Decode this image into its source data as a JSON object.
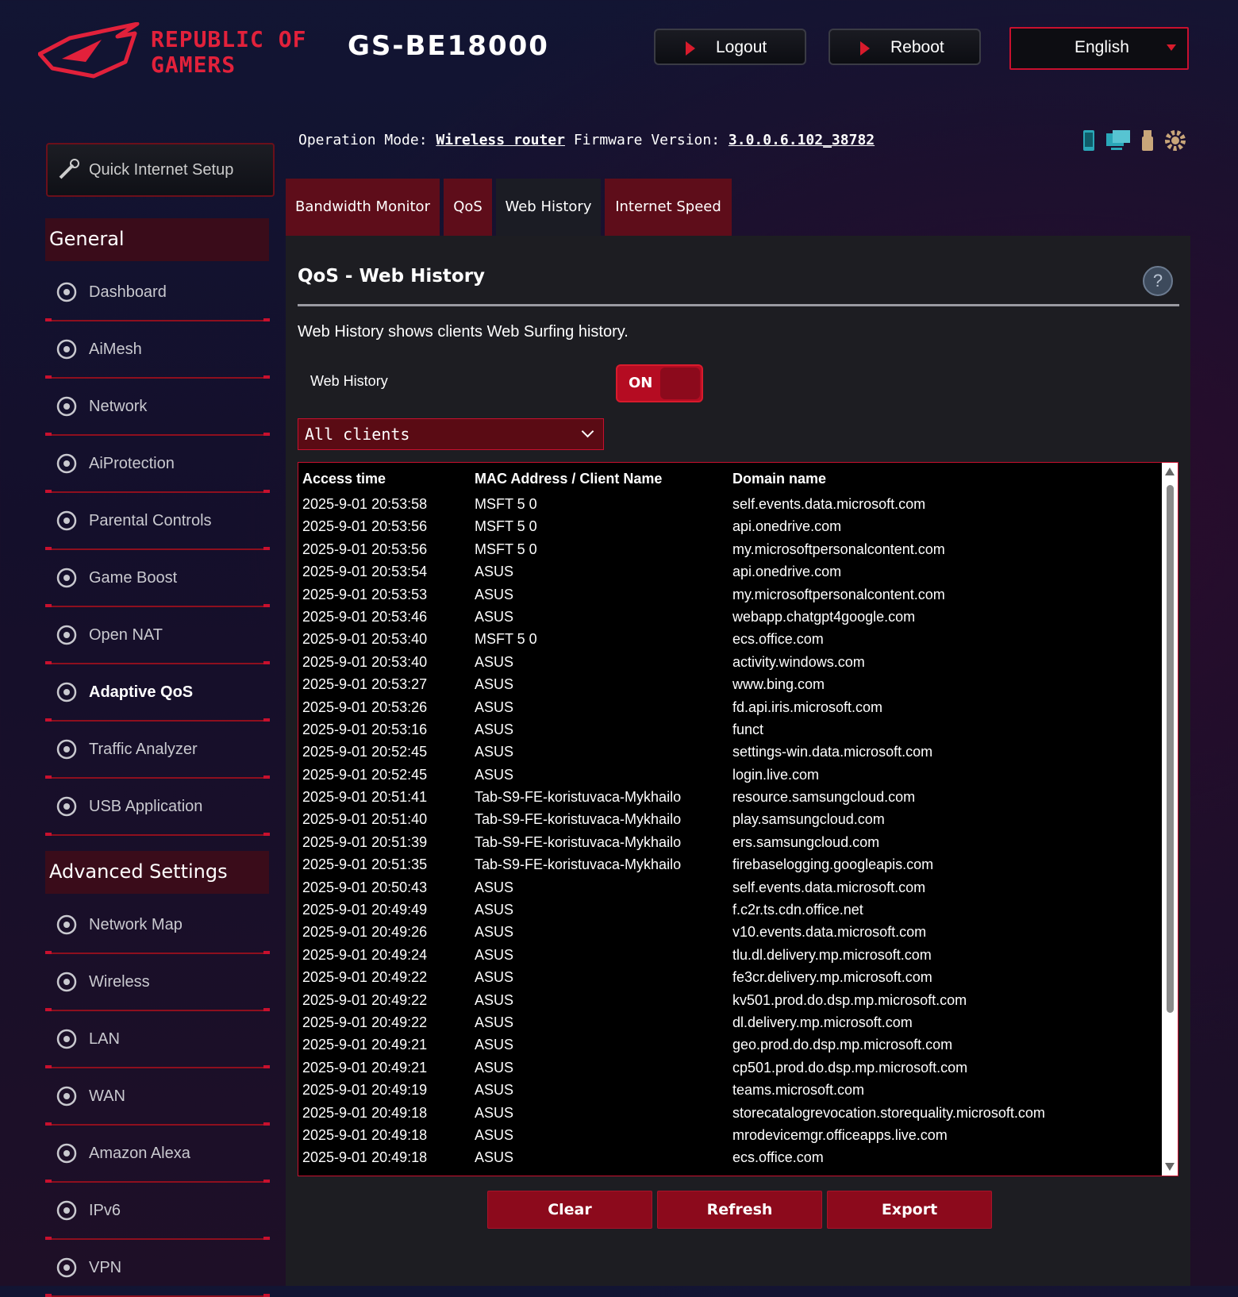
{
  "header": {
    "brand_line1": "REPUBLIC OF",
    "brand_line2": "GAMERS",
    "model": "GS-BE18000",
    "logout_label": "Logout",
    "reboot_label": "Reboot",
    "language": "English",
    "accent_color": "#c8102e"
  },
  "info": {
    "op_mode_label": "Operation Mode:",
    "op_mode_value": "Wireless router",
    "fw_label": "Firmware Version:",
    "fw_value": "3.0.0.6.102_38782"
  },
  "sidebar": {
    "quick_setup": "Quick Internet Setup",
    "general_title": "General",
    "general_items": [
      {
        "label": "Dashboard",
        "icon": "dashboard-icon"
      },
      {
        "label": "AiMesh",
        "icon": "aimesh-icon"
      },
      {
        "label": "Network",
        "icon": "network-icon"
      },
      {
        "label": "AiProtection",
        "icon": "shield-icon"
      },
      {
        "label": "Parental Controls",
        "icon": "family-icon"
      },
      {
        "label": "Game Boost",
        "icon": "rocket-icon"
      },
      {
        "label": "Open NAT",
        "icon": "server-icon"
      },
      {
        "label": "Adaptive QoS",
        "icon": "speedometer-icon",
        "active": true
      },
      {
        "label": "Traffic Analyzer",
        "icon": "analyzer-icon"
      },
      {
        "label": "USB Application",
        "icon": "usb-icon"
      }
    ],
    "advanced_title": "Advanced Settings",
    "advanced_items": [
      {
        "label": "Network Map",
        "icon": "globe-icon"
      },
      {
        "label": "Wireless",
        "icon": "wifi-icon"
      },
      {
        "label": "LAN",
        "icon": "lan-icon"
      },
      {
        "label": "WAN",
        "icon": "globe-icon"
      },
      {
        "label": "Amazon Alexa",
        "icon": "alexa-icon"
      },
      {
        "label": "IPv6",
        "icon": "ipv6-icon"
      },
      {
        "label": "VPN",
        "icon": "vpn-icon"
      }
    ]
  },
  "tabs": [
    {
      "label": "Bandwidth Monitor"
    },
    {
      "label": "QoS"
    },
    {
      "label": "Web History",
      "active": true
    },
    {
      "label": "Internet Speed"
    }
  ],
  "panel": {
    "title": "QoS - Web History",
    "description": "Web History shows clients Web Surfing history.",
    "toggle_label": "Web History",
    "toggle_state": "ON",
    "client_filter": "All clients",
    "columns": [
      "Access time",
      "MAC Address / Client Name",
      "Domain name"
    ],
    "rows": [
      [
        "2025-9-01  20:53:58",
        "MSFT 5 0",
        "self.events.data.microsoft.com"
      ],
      [
        "2025-9-01  20:53:56",
        "MSFT 5 0",
        "api.onedrive.com"
      ],
      [
        "2025-9-01  20:53:56",
        "MSFT 5 0",
        "my.microsoftpersonalcontent.com"
      ],
      [
        "2025-9-01  20:53:54",
        "ASUS",
        "api.onedrive.com"
      ],
      [
        "2025-9-01  20:53:53",
        "ASUS",
        "my.microsoftpersonalcontent.com"
      ],
      [
        "2025-9-01  20:53:46",
        "ASUS",
        "webapp.chatgpt4google.com"
      ],
      [
        "2025-9-01  20:53:40",
        "MSFT 5 0",
        "ecs.office.com"
      ],
      [
        "2025-9-01  20:53:40",
        "ASUS",
        "activity.windows.com"
      ],
      [
        "2025-9-01  20:53:27",
        "ASUS",
        "www.bing.com"
      ],
      [
        "2025-9-01  20:53:26",
        "ASUS",
        "fd.api.iris.microsoft.com"
      ],
      [
        "2025-9-01  20:53:16",
        "ASUS",
        "funct"
      ],
      [
        "2025-9-01  20:52:45",
        "ASUS",
        "settings-win.data.microsoft.com"
      ],
      [
        "2025-9-01  20:52:45",
        "ASUS",
        "login.live.com"
      ],
      [
        "2025-9-01  20:51:41",
        "Tab-S9-FE-koristuvaca-Mykhailo",
        "resource.samsungcloud.com"
      ],
      [
        "2025-9-01  20:51:40",
        "Tab-S9-FE-koristuvaca-Mykhailo",
        "play.samsungcloud.com"
      ],
      [
        "2025-9-01  20:51:39",
        "Tab-S9-FE-koristuvaca-Mykhailo",
        "ers.samsungcloud.com"
      ],
      [
        "2025-9-01  20:51:35",
        "Tab-S9-FE-koristuvaca-Mykhailo",
        "firebaselogging.googleapis.com"
      ],
      [
        "2025-9-01  20:50:43",
        "ASUS",
        "self.events.data.microsoft.com"
      ],
      [
        "2025-9-01  20:49:49",
        "ASUS",
        "f.c2r.ts.cdn.office.net"
      ],
      [
        "2025-9-01  20:49:26",
        "ASUS",
        "v10.events.data.microsoft.com"
      ],
      [
        "2025-9-01  20:49:24",
        "ASUS",
        "tlu.dl.delivery.mp.microsoft.com"
      ],
      [
        "2025-9-01  20:49:22",
        "ASUS",
        "fe3cr.delivery.mp.microsoft.com"
      ],
      [
        "2025-9-01  20:49:22",
        "ASUS",
        "kv501.prod.do.dsp.mp.microsoft.com"
      ],
      [
        "2025-9-01  20:49:22",
        "ASUS",
        "dl.delivery.mp.microsoft.com"
      ],
      [
        "2025-9-01  20:49:21",
        "ASUS",
        "geo.prod.do.dsp.mp.microsoft.com"
      ],
      [
        "2025-9-01  20:49:21",
        "ASUS",
        "cp501.prod.do.dsp.mp.microsoft.com"
      ],
      [
        "2025-9-01  20:49:19",
        "ASUS",
        "teams.microsoft.com"
      ],
      [
        "2025-9-01  20:49:18",
        "ASUS",
        "storecatalogrevocation.storequality.microsoft.com"
      ],
      [
        "2025-9-01  20:49:18",
        "ASUS",
        "mrodevicemgr.officeapps.live.com"
      ],
      [
        "2025-9-01  20:49:18",
        "ASUS",
        "ecs.office.com"
      ]
    ],
    "clear_label": "Clear",
    "refresh_label": "Refresh",
    "export_label": "Export"
  }
}
